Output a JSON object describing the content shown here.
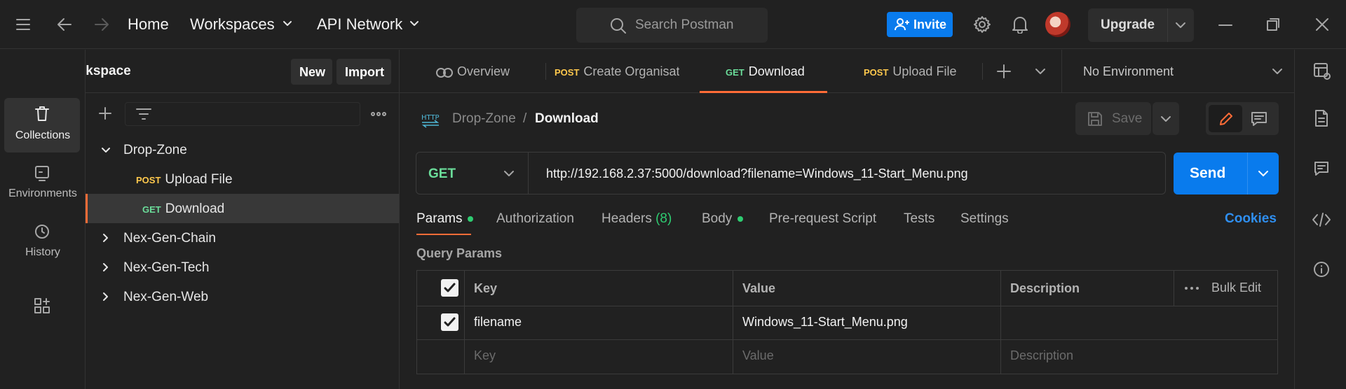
{
  "topbar": {
    "home": "Home",
    "workspaces": "Workspaces",
    "api_network": "API Network",
    "search_placeholder": "Search Postman",
    "invite": "Invite",
    "upgrade": "Upgrade"
  },
  "workspace": {
    "title": "My Workspace",
    "new_label": "New",
    "import_label": "Import"
  },
  "rail": {
    "items": [
      {
        "label": "Collections",
        "icon": "trash-can-icon"
      },
      {
        "label": "Environments",
        "icon": "environment-icon"
      },
      {
        "label": "History",
        "icon": "history-icon"
      }
    ]
  },
  "tree": {
    "collections": [
      {
        "name": "Drop-Zone",
        "expanded": true,
        "requests": [
          {
            "method": "POST",
            "name": "Upload File"
          },
          {
            "method": "GET",
            "name": "Download"
          }
        ]
      },
      {
        "name": "Nex-Gen-Chain",
        "expanded": false
      },
      {
        "name": "Nex-Gen-Tech",
        "expanded": false
      },
      {
        "name": "Nex-Gen-Web",
        "expanded": false
      }
    ]
  },
  "tabs": [
    {
      "method": "",
      "label": "Overview"
    },
    {
      "method": "POST",
      "label": "Create Organisati"
    },
    {
      "method": "GET",
      "label": "Download"
    },
    {
      "method": "POST",
      "label": "Upload File"
    }
  ],
  "environment": "No Environment",
  "request": {
    "breadcrumb_collection": "Drop-Zone",
    "breadcrumb_sep": "/",
    "breadcrumb_request": "Download",
    "save_label": "Save",
    "method": "GET",
    "url": "http://192.168.2.37:5000/download?filename=Windows_11-Start_Menu.png",
    "send_label": "Send",
    "subtabs": {
      "params": "Params",
      "authorization": "Authorization",
      "headers": "Headers",
      "headers_count": "(8)",
      "body": "Body",
      "prerequest": "Pre-request Script",
      "tests": "Tests",
      "settings": "Settings",
      "cookies": "Cookies"
    },
    "query_params_title": "Query Params",
    "table": {
      "headers": {
        "key": "Key",
        "value": "Value",
        "description": "Description",
        "bulk_edit": "Bulk Edit"
      },
      "rows": [
        {
          "checked": true,
          "key": "filename",
          "value": "Windows_11-Start_Menu.png",
          "description": ""
        }
      ],
      "placeholder": {
        "key": "Key",
        "value": "Value",
        "description": "Description"
      }
    }
  },
  "colors": {
    "accent_blue": "#097bed",
    "accent_orange": "#ff6c37",
    "get_green": "#6bdd9a",
    "post_yellow": "#ffc94d"
  }
}
